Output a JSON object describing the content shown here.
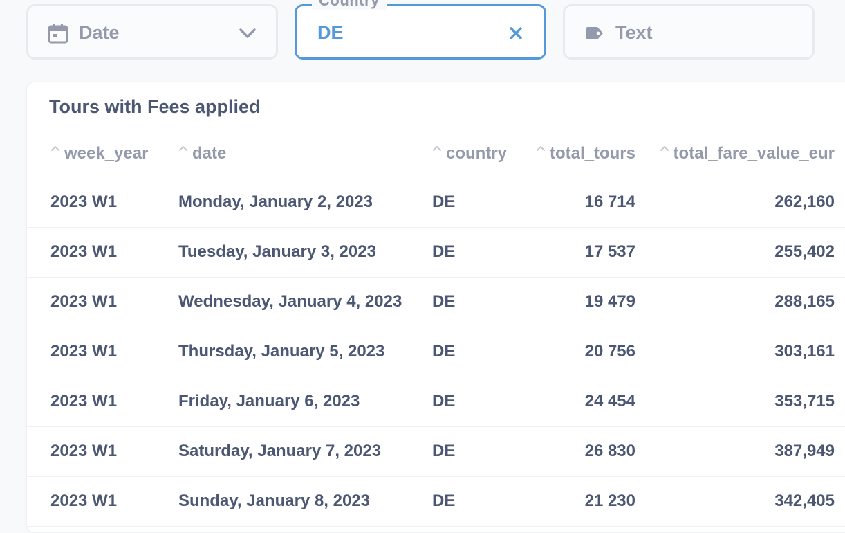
{
  "filters": {
    "date": {
      "placeholder": "Date",
      "icon": "calendar-icon"
    },
    "country": {
      "label": "Country",
      "value": "DE",
      "icon": "close-icon"
    },
    "text": {
      "placeholder": "Text",
      "icon": "tag-icon"
    }
  },
  "card": {
    "title": "Tours with Fees applied"
  },
  "table": {
    "columns": [
      "week_year",
      "date",
      "country",
      "total_tours",
      "total_fare_value_eur"
    ],
    "rows": [
      [
        "2023 W1",
        "Monday, January 2, 2023",
        "DE",
        "16 714",
        "262,160"
      ],
      [
        "2023 W1",
        "Tuesday, January 3, 2023",
        "DE",
        "17 537",
        "255,402"
      ],
      [
        "2023 W1",
        "Wednesday, January 4, 2023",
        "DE",
        "19 479",
        "288,165"
      ],
      [
        "2023 W1",
        "Thursday, January 5, 2023",
        "DE",
        "20 756",
        "303,161"
      ],
      [
        "2023 W1",
        "Friday, January 6, 2023",
        "DE",
        "24 454",
        "353,715"
      ],
      [
        "2023 W1",
        "Saturday, January 7, 2023",
        "DE",
        "26 830",
        "387,949"
      ],
      [
        "2023 W1",
        "Sunday, January 8, 2023",
        "DE",
        "21 230",
        "342,405"
      ]
    ]
  },
  "colors": {
    "accent": "#5499d8",
    "text": "#4c5773",
    "muted": "#949aab",
    "border": "#eef0f3"
  }
}
